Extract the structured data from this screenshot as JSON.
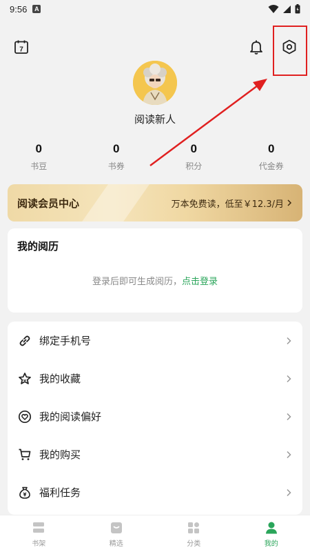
{
  "status_bar": {
    "time": "9:56",
    "notification_badge": "A"
  },
  "header": {
    "calendar_icon": "calendar-icon",
    "calendar_day": "7",
    "bell_icon": "bell-icon",
    "settings_icon": "settings-icon"
  },
  "profile": {
    "username": "阅读新人"
  },
  "stats": [
    {
      "value": "0",
      "label": "书豆"
    },
    {
      "value": "0",
      "label": "书券"
    },
    {
      "value": "0",
      "label": "积分"
    },
    {
      "value": "0",
      "label": "代金券"
    }
  ],
  "vip": {
    "title": "阅读会员中心",
    "promo": "万本免费读，低至￥12.3/月"
  },
  "history": {
    "title": "我的阅历",
    "hint": "登录后即可生成阅历，",
    "login_link": "点击登录"
  },
  "menu": [
    {
      "label": "绑定手机号",
      "icon": "link-icon"
    },
    {
      "label": "我的收藏",
      "icon": "star-icon"
    },
    {
      "label": "我的阅读偏好",
      "icon": "heart-icon"
    },
    {
      "label": "我的购买",
      "icon": "cart-icon"
    },
    {
      "label": "福利任务",
      "icon": "money-bag-icon"
    }
  ],
  "tabs": [
    {
      "label": "书架",
      "icon": "bookshelf-icon"
    },
    {
      "label": "精选",
      "icon": "featured-icon"
    },
    {
      "label": "分类",
      "icon": "category-icon"
    },
    {
      "label": "我的",
      "icon": "profile-icon"
    }
  ],
  "colors": {
    "accent": "#2aa55a",
    "annotation": "#e02020",
    "vip_text": "#3d2a10"
  }
}
